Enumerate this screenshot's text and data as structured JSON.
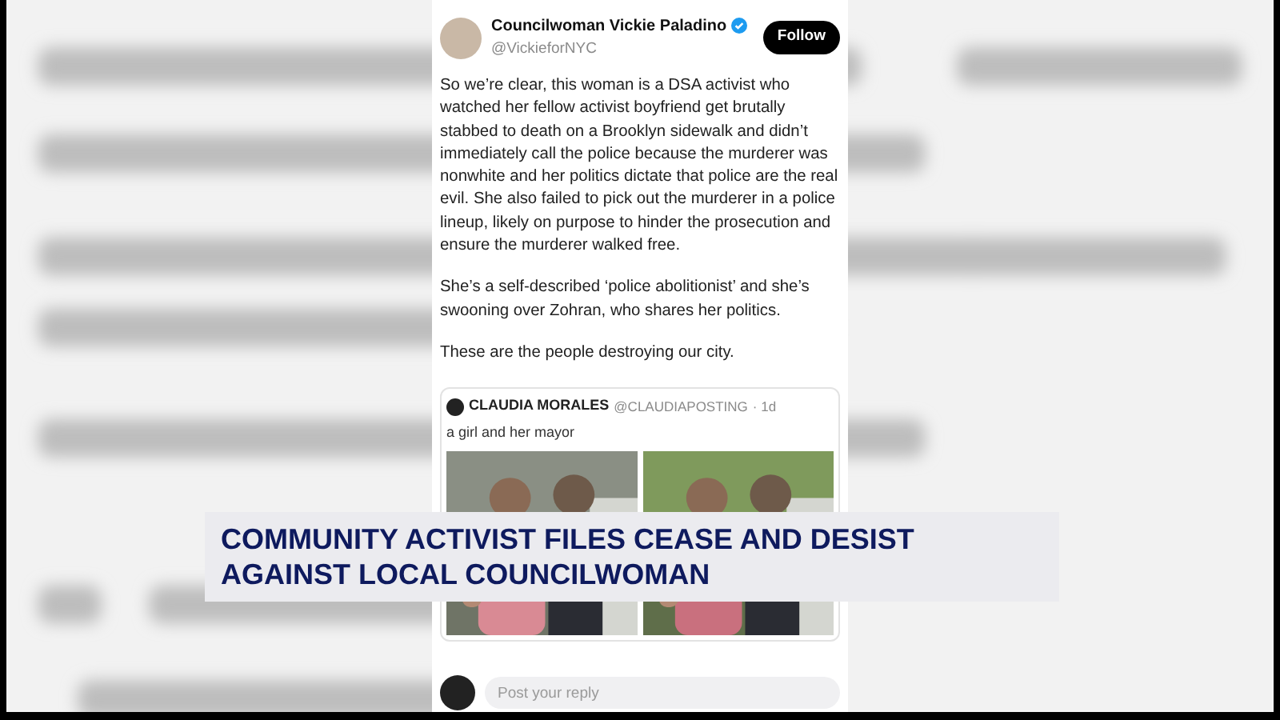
{
  "post": {
    "author": "Councilwoman Vickie Paladino",
    "handle": "@VickieforNYC",
    "verified": true,
    "follow_button": "Follow",
    "paragraphs": [
      "So we’re clear, this woman is a DSA activist who watched her fellow activist boyfriend get brutally stabbed to death on a Brooklyn sidewalk and didn’t immediately call the police because the murderer was nonwhite and her politics dictate that police are the real evil. She also failed to pick out the murderer in a police lineup, likely on purpose to hinder the prosecution and ensure the murderer walked free.",
      "She’s a self-described ‘police abolitionist’ and she’s swooning over Zohran, who shares her politics.",
      "These are the people destroying our city."
    ],
    "quote": {
      "author": "CLAUDIA MORALES",
      "handle": "@CLAUDIAPOSTING",
      "time": "· 1d",
      "text": "a girl and her mayor"
    },
    "reply": {
      "placeholder": "Post your reply"
    }
  },
  "headline": {
    "lines": [
      "COMMUNITY ACTIVIST FILES CEASE AND DESIST",
      "AGAINST LOCAL COUNCILWOMAN"
    ]
  }
}
